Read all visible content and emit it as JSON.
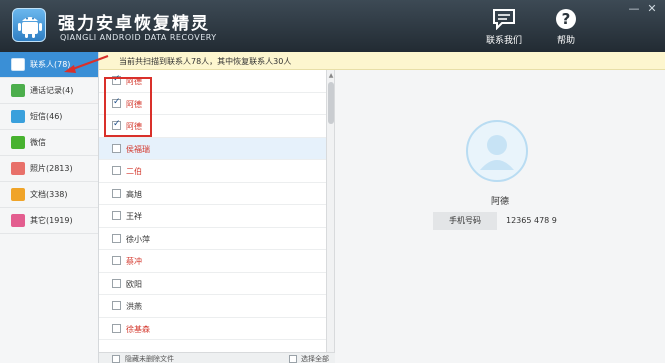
{
  "app": {
    "title": "强力安卓恢复精灵",
    "subtitle": "QIANGLI ANDROID DATA RECOVERY",
    "contact_us": "联系我们",
    "help": "帮助",
    "help_glyph": "?"
  },
  "window_controls": {
    "minimize": "—",
    "close": "✕"
  },
  "sidebar": {
    "items": [
      {
        "label": "联系人(78)",
        "icon": "contacts-icon",
        "color": "#ffffff"
      },
      {
        "label": "通话记录(4)",
        "icon": "call-log-icon",
        "color": "#4cae4c"
      },
      {
        "label": "短信(46)",
        "icon": "sms-icon",
        "color": "#3aa0dc"
      },
      {
        "label": "微信",
        "icon": "wechat-icon",
        "color": "#47b22f"
      },
      {
        "label": "照片(2813)",
        "icon": "photo-icon",
        "color": "#e8706a"
      },
      {
        "label": "文档(338)",
        "icon": "document-icon",
        "color": "#f0a429"
      },
      {
        "label": "其它(1919)",
        "icon": "other-icon",
        "color": "#e35d8f"
      }
    ]
  },
  "info_bar": {
    "text": "当前共扫描到联系人78人，其中恢复联系人30人"
  },
  "contacts": [
    {
      "name": "阿德",
      "red": true,
      "checked": true
    },
    {
      "name": "阿德",
      "red": true,
      "checked": true
    },
    {
      "name": "阿德",
      "red": true,
      "checked": true
    },
    {
      "name": "侯福瑞",
      "red": true,
      "checked": false
    },
    {
      "name": "二伯",
      "red": true,
      "checked": false
    },
    {
      "name": "高旭",
      "red": false,
      "checked": false
    },
    {
      "name": "王祥",
      "red": false,
      "checked": false
    },
    {
      "name": "徐小萍",
      "red": false,
      "checked": false
    },
    {
      "name": "蔡冲",
      "red": true,
      "checked": false
    },
    {
      "name": "欧阳",
      "red": false,
      "checked": false
    },
    {
      "name": "洪燕",
      "red": false,
      "checked": false
    },
    {
      "name": "徐基森",
      "red": true,
      "checked": false
    }
  ],
  "bottom": {
    "hide_deleted": "隐藏未删除文件",
    "select_all": "选择全部"
  },
  "detail": {
    "name": "阿德",
    "phone_label": "手机号码",
    "phone_value": "12365 478 9"
  },
  "colors": {
    "accent": "#3a8fd6",
    "deleted_red": "#d43a2f",
    "annotation": "#d9302a"
  }
}
